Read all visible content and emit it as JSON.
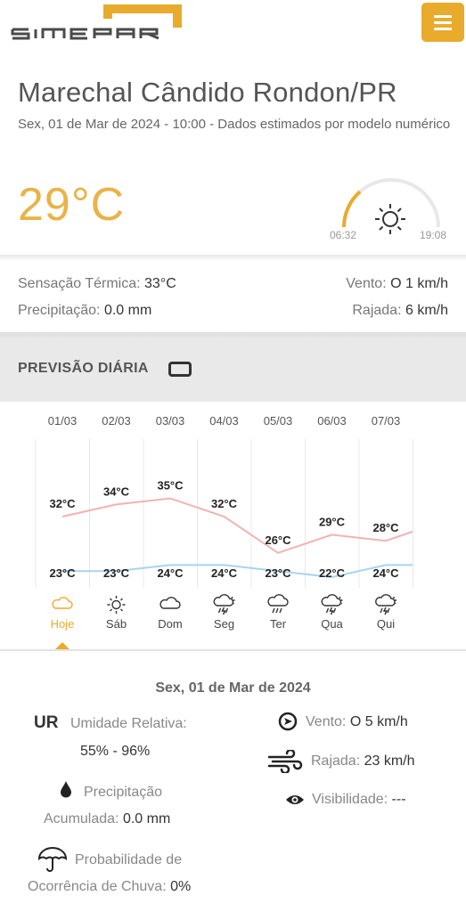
{
  "header": {
    "logo_text": "SIMEPAR",
    "menu_icon": "hamburger-icon",
    "brand_color": "#e9ab2c"
  },
  "current": {
    "city": "Marechal Cândido Rondon/PR",
    "subtitle": "Sex, 01 de Mar de 2024 - 10:00 - Dados estimados por modelo numérico",
    "temperature": "29°C",
    "sunrise": "06:32",
    "sunset": "19:08",
    "day_progress": 0.27,
    "weather_icon": "sun-icon",
    "feels_like_label": "Sensação Térmica:",
    "feels_like_value": "33°C",
    "precip_label": "Precipitação:",
    "precip_value": "0.0 mm",
    "wind_label": "Vento:",
    "wind_value": "O 1 km/h",
    "gust_label": "Rajada:",
    "gust_value": "6 km/h"
  },
  "forecast": {
    "title": "PREVISÃO DIÁRIA",
    "title_icon": "device-icon",
    "selected_index": 0
  },
  "chart_data": {
    "type": "line",
    "categories": [
      "01/03",
      "02/03",
      "03/03",
      "04/03",
      "05/03",
      "06/03",
      "07/03"
    ],
    "day_labels": [
      "Hoje",
      "Sáb",
      "Dom",
      "Seg",
      "Ter",
      "Qua",
      "Qui"
    ],
    "icons": [
      "partly-cloudy-icon",
      "sun-icon",
      "cloud-icon",
      "thunderstorm-icon",
      "rain-icon",
      "thunderstorm-icon",
      "thunderstorm-icon"
    ],
    "series": [
      {
        "values": [
          32,
          34,
          35,
          32,
          26,
          29,
          28
        ],
        "labels": [
          "32°C",
          "34°C",
          "35°C",
          "32°C",
          "26°C",
          "29°C",
          "28°C"
        ],
        "color": "#f0b3b3"
      },
      {
        "values": [
          23,
          23,
          24,
          24,
          23,
          22,
          24
        ],
        "labels": [
          "23°C",
          "23°C",
          "24°C",
          "24°C",
          "23°C",
          "22°C",
          "24°C"
        ],
        "color": "#a8d4ee"
      }
    ]
  },
  "details": {
    "date": "Sex, 01 de Mar de 2024",
    "ur_abbr": "UR",
    "ur_label": "Umidade Relativa:",
    "ur_value": "55% - 96%",
    "precip_line1": "Precipitação",
    "precip_line2": "Acumulada:",
    "precip_value": "0.0 mm",
    "prob_line1": "Probabilidade de",
    "prob_line2": "Ocorrência de Chuva:",
    "prob_value": "0%",
    "wind_label": "Vento:",
    "wind_value": "O 5 km/h",
    "gust_label": "Rajada:",
    "gust_value": "23 km/h",
    "vis_label": "Visibilidade:",
    "vis_value": "---"
  }
}
